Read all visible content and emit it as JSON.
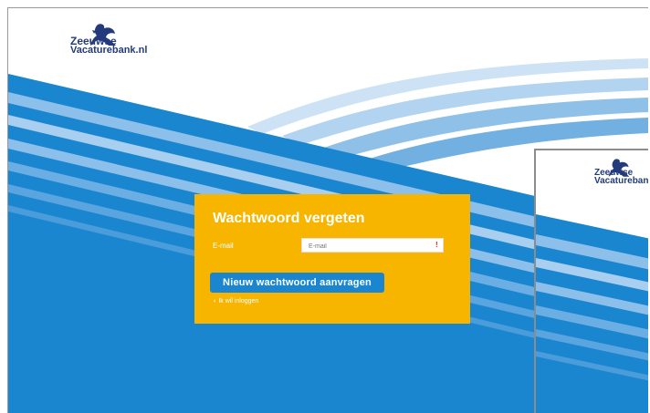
{
  "brand": {
    "logo_line1": "Zeeuwse",
    "logo_line2": "Vacaturebank.nl",
    "logo2_line2": "Vacaturebank."
  },
  "colors": {
    "accent_yellow": "#f7b500",
    "primary_blue": "#1b86cf",
    "required": "#e0251b"
  },
  "form": {
    "title": "Wachtwoord vergeten",
    "email_label": "E-mail",
    "email_placeholder": "E-mail",
    "email_value": "",
    "required_marker": "!",
    "submit_label": "Nieuw wachtwoord aanvragen",
    "back_chevron": "‹",
    "back_label": "Ik wil inloggen"
  }
}
